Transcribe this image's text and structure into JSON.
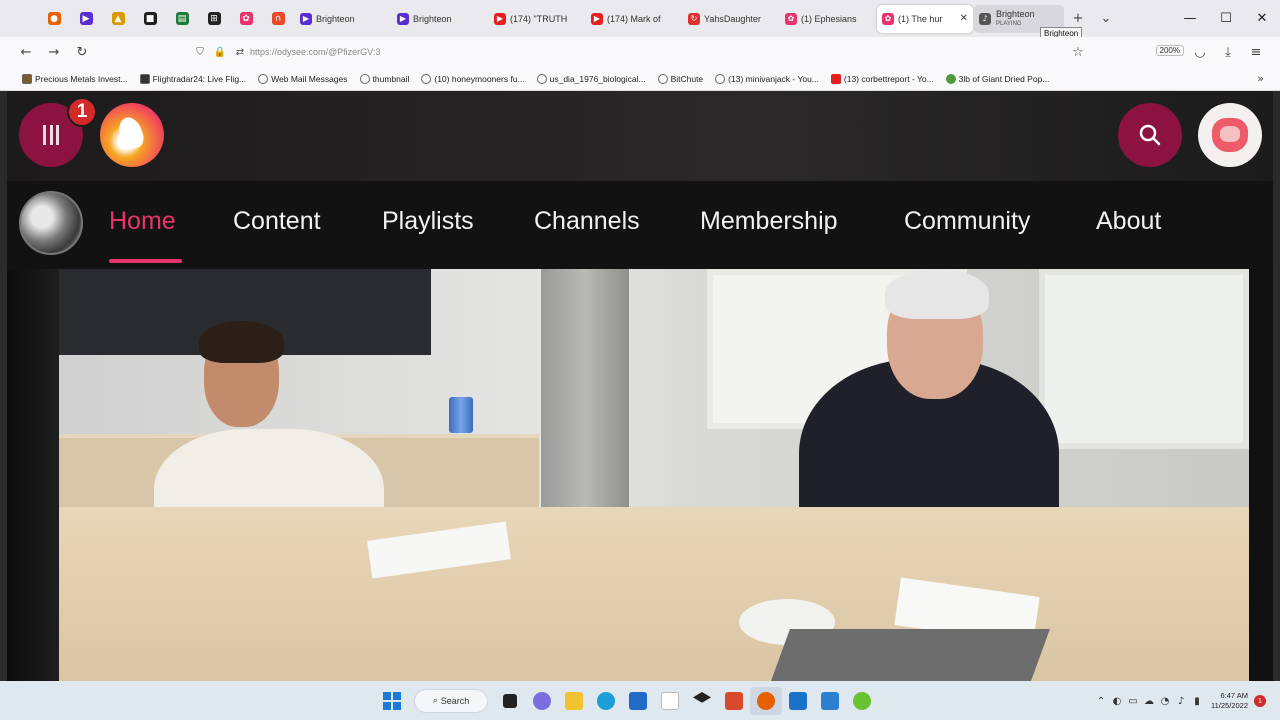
{
  "browser": {
    "pinned_tabs": [
      {
        "icon": "firefox-icon",
        "color": "#e66000"
      },
      {
        "icon": "brighteon-icon",
        "color": "#5a2dd0"
      },
      {
        "icon": "bitwarden-icon",
        "color": "#d99a00"
      },
      {
        "icon": "app-icon",
        "color": "#1e1e1e"
      },
      {
        "icon": "sheet-icon",
        "color": "#1e7b3a"
      },
      {
        "icon": "grid-icon",
        "color": "#222222"
      },
      {
        "icon": "odysee-icon",
        "color": "#e8336c"
      },
      {
        "icon": "rumble-icon",
        "color": "#e54b2a"
      }
    ],
    "tabs": [
      {
        "label": "Brighteon",
        "icon": "brighteon-icon",
        "color": "#5a2dd0"
      },
      {
        "label": "Brighteon",
        "icon": "brighteon-icon",
        "color": "#5a2dd0"
      },
      {
        "label": "(174) \"TRUTH",
        "icon": "youtube-icon",
        "color": "#e52020"
      },
      {
        "label": "(174) Mark of",
        "icon": "youtube-icon",
        "color": "#e52020"
      },
      {
        "label": "YahsDaughter",
        "icon": "refresh-icon",
        "color": "#e03030"
      },
      {
        "label": "(1) Ephesians",
        "icon": "odysee-icon",
        "color": "#e8336c"
      },
      {
        "label": "(1) The hur",
        "icon": "odysee-icon",
        "color": "#e8336c"
      },
      {
        "label": "Brighteon",
        "sub": "PLAYING",
        "icon": "speaker-icon",
        "color": "#555555"
      }
    ],
    "new_tab": "+",
    "tab_list": "⌄",
    "tooltip": "Brighteon",
    "url": "https://odysee.com/@PfizerGV:3",
    "zoom": "200%"
  },
  "bookmarks": [
    "Precious Metals Invest...",
    "Flightradar24: Live Flig...",
    "Web Mail Messages",
    "thumbnail",
    "(10) honeymooners fu...",
    "us_dia_1976_biological...",
    "BitChute",
    "(13) minivanjack - You...",
    "(13) corbettreport - Yo...",
    "3lb of Giant Dried Pop..."
  ],
  "site": {
    "notification_count": "1",
    "nav_tabs": [
      "Home",
      "Content",
      "Playlists",
      "Channels",
      "Membership",
      "Community",
      "About"
    ],
    "accent": "#e8336c",
    "button_color": "#8c1340"
  },
  "taskbar": {
    "search_label": "Search",
    "time": "6:47 AM",
    "date": "11/25/2022",
    "badge": "1"
  }
}
